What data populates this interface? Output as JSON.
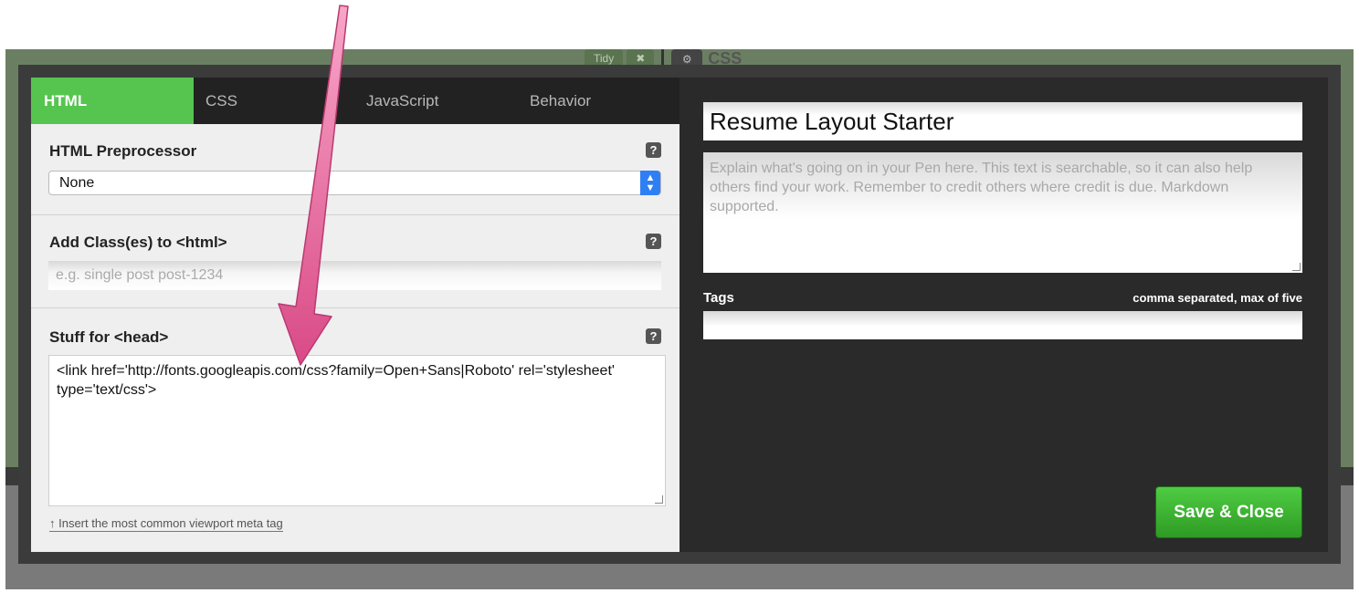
{
  "background_editor": {
    "tidy_label": "Tidy",
    "close_symbol": "✖",
    "gear_symbol": "⚙",
    "css_label": "CSS"
  },
  "tabs": [
    {
      "label": "HTML",
      "active": true
    },
    {
      "label": "CSS",
      "active": false
    },
    {
      "label": "JavaScript",
      "active": false
    },
    {
      "label": "Behavior",
      "active": false
    }
  ],
  "html_settings": {
    "preprocessor": {
      "title": "HTML Preprocessor",
      "selected": "None",
      "help": "?"
    },
    "html_classes": {
      "title": "Add Class(es) to <html>",
      "placeholder": "e.g. single post post-1234",
      "help": "?"
    },
    "head_stuff": {
      "title": "Stuff for <head>",
      "value": "<link href='http://fonts.googleapis.com/css?family=Open+Sans|Roboto' rel='stylesheet' type='text/css'>",
      "help": "?",
      "meta_link": "↑ Insert the most common viewport meta tag"
    }
  },
  "pen_info": {
    "title_value": "Resume Layout Starter",
    "description_placeholder": "Explain what's going on in your Pen here. This text is searchable, so it can also help others find your work. Remember to credit others where credit is due. Markdown supported.",
    "tags_label": "Tags",
    "tags_hint": "comma separated, max of five",
    "tags_value": ""
  },
  "save_button": "Save & Close",
  "colors": {
    "accent_green": "#56c54f",
    "arrow_pink": "#e0558f",
    "save_green": "#3bb32f"
  }
}
